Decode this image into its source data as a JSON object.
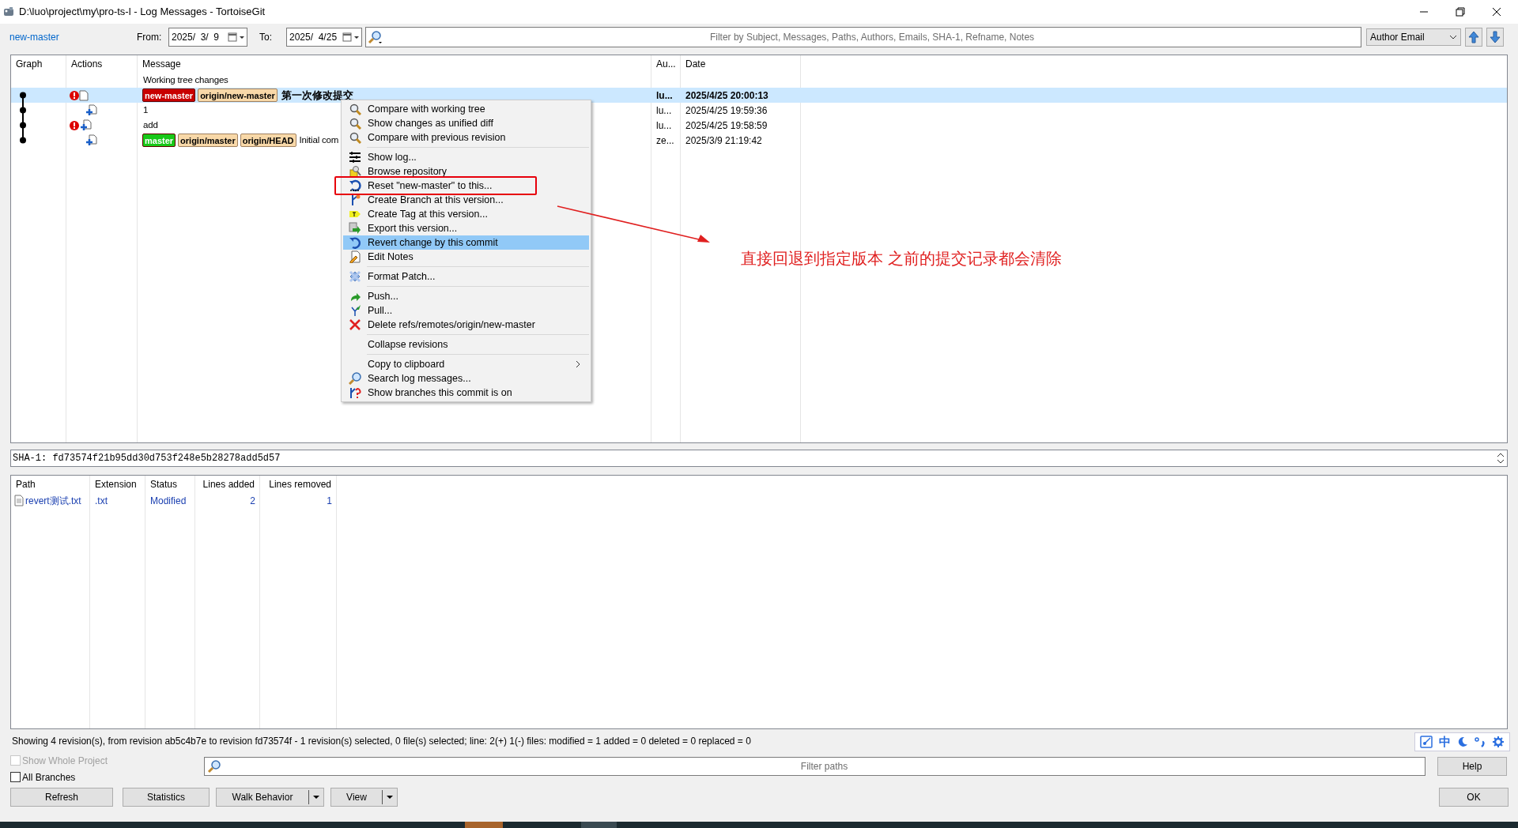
{
  "window": {
    "title": "D:\\luo\\project\\my\\pro-ts-l - Log Messages - TortoiseGit"
  },
  "toolbar": {
    "branch_link": "new-master",
    "from_label": "From:",
    "from_date": "2025/  3/  9",
    "to_label": "To:",
    "to_date": "2025/  4/25",
    "filter_placeholder": "Filter by Subject, Messages, Paths, Authors, Emails, SHA-1, Refname, Notes",
    "filter_field": "Author Email"
  },
  "log": {
    "columns": [
      "Graph",
      "Actions",
      "Message",
      "Au...",
      "Date"
    ],
    "rows": [
      {
        "kind": "working_tree",
        "message": "Working tree changes",
        "selected": false
      },
      {
        "kind": "commit",
        "alert": true,
        "added": false,
        "refs": [
          {
            "label": "new-master",
            "color": "#c80000"
          },
          {
            "label": "origin/new-master",
            "color": "#f8d8a8"
          }
        ],
        "message": "第一次修改提交",
        "author": "lu...",
        "date": "2025/4/25 20:00:13",
        "selected": true
      },
      {
        "kind": "commit",
        "alert": false,
        "added": true,
        "refs": [],
        "message": "1",
        "author": "lu...",
        "date": "2025/4/25 19:59:36",
        "selected": false
      },
      {
        "kind": "commit",
        "alert": true,
        "added": true,
        "refs": [],
        "message": "add",
        "author": "lu...",
        "date": "2025/4/25 19:58:59",
        "selected": false
      },
      {
        "kind": "commit",
        "alert": false,
        "added": true,
        "refs": [
          {
            "label": "master",
            "color": "#18c818"
          },
          {
            "label": "origin/master",
            "color": "#f8d8a8"
          },
          {
            "label": "origin/HEAD",
            "color": "#f8d8a8"
          }
        ],
        "message": "Initial com",
        "author": "ze...",
        "date": "2025/3/9 21:19:42",
        "selected": false
      }
    ]
  },
  "context_menu": {
    "groups": [
      {
        "items": [
          {
            "label": "Compare with working tree",
            "kind": "compare",
            "selected": false,
            "annotated": false,
            "submenu": false
          },
          {
            "label": "Show changes as unified diff",
            "kind": "compare",
            "selected": false,
            "annotated": false,
            "submenu": false
          },
          {
            "label": "Compare with previous revision",
            "kind": "compare",
            "selected": false,
            "annotated": false,
            "submenu": false
          }
        ]
      },
      {
        "items": [
          {
            "label": "Show log...",
            "kind": "log",
            "selected": false,
            "annotated": false,
            "submenu": false
          },
          {
            "label": "Browse repository",
            "kind": "browse",
            "selected": false,
            "annotated": false,
            "submenu": false
          },
          {
            "label": "Reset \"new-master\" to this...",
            "kind": "reset",
            "selected": false,
            "annotated": true,
            "submenu": false
          },
          {
            "label": "Create Branch at this version...",
            "kind": "branch",
            "selected": false,
            "annotated": false,
            "submenu": false
          },
          {
            "label": "Create Tag at this version...",
            "kind": "tag",
            "selected": false,
            "annotated": false,
            "submenu": false
          },
          {
            "label": "Export this version...",
            "kind": "export",
            "selected": false,
            "annotated": false,
            "submenu": false
          },
          {
            "label": "Revert change by this commit",
            "kind": "revert",
            "selected": true,
            "annotated": false,
            "submenu": false
          },
          {
            "label": "Edit Notes",
            "kind": "notes",
            "selected": false,
            "annotated": false,
            "submenu": false
          }
        ]
      },
      {
        "items": [
          {
            "label": "Format Patch...",
            "kind": "patch",
            "selected": false,
            "annotated": false,
            "submenu": false
          }
        ]
      },
      {
        "items": [
          {
            "label": "Push...",
            "kind": "push",
            "selected": false,
            "annotated": false,
            "submenu": false
          },
          {
            "label": "Pull...",
            "kind": "pull",
            "selected": false,
            "annotated": false,
            "submenu": false
          },
          {
            "label": "Delete refs/remotes/origin/new-master",
            "kind": "delete",
            "selected": false,
            "annotated": false,
            "submenu": false
          }
        ]
      },
      {
        "items": [
          {
            "label": "Collapse revisions",
            "kind": "none",
            "selected": false,
            "annotated": false,
            "submenu": false
          }
        ]
      },
      {
        "items": [
          {
            "label": "Copy to clipboard",
            "kind": "none",
            "selected": false,
            "annotated": false,
            "submenu": true
          },
          {
            "label": "Search log messages...",
            "kind": "search",
            "selected": false,
            "annotated": false,
            "submenu": false
          },
          {
            "label": "Show branches this commit is on",
            "kind": "branches",
            "selected": false,
            "annotated": false,
            "submenu": false
          }
        ]
      }
    ]
  },
  "annotation": {
    "text": "直接回退到指定版本 之前的提交记录都会清除"
  },
  "sha": "SHA-1: fd73574f21b95dd30d753f248e5b28278add5d57",
  "files": {
    "columns": [
      "Path",
      "Extension",
      "Status",
      "Lines added",
      "Lines removed"
    ],
    "rows": [
      {
        "path": "revert测试.txt",
        "extension": ".txt",
        "status": "Modified",
        "lines_added": "2",
        "lines_removed": "1"
      }
    ]
  },
  "status_text": "Showing 4 revision(s), from revision ab5c4b7e to revision fd73574f - 1 revision(s) selected, 0 file(s) selected; line: 2(+) 1(-) files: modified = 1 added = 0 deleted = 0 replaced = 0",
  "show_whole_project": {
    "label": "Show Whole Project",
    "checked": false,
    "disabled": true
  },
  "all_branches": {
    "label": "All Branches",
    "checked": false,
    "disabled": false
  },
  "filter_paths_placeholder": "Filter paths",
  "buttons": [
    {
      "label": "Refresh",
      "dropdown": false
    },
    {
      "label": "Statistics",
      "dropdown": false
    },
    {
      "label": "Walk Behavior",
      "dropdown": true
    },
    {
      "label": "View",
      "dropdown": true
    }
  ],
  "help_button": "Help",
  "ok_button": "OK",
  "ime_toolbar": {
    "mode": "中"
  }
}
